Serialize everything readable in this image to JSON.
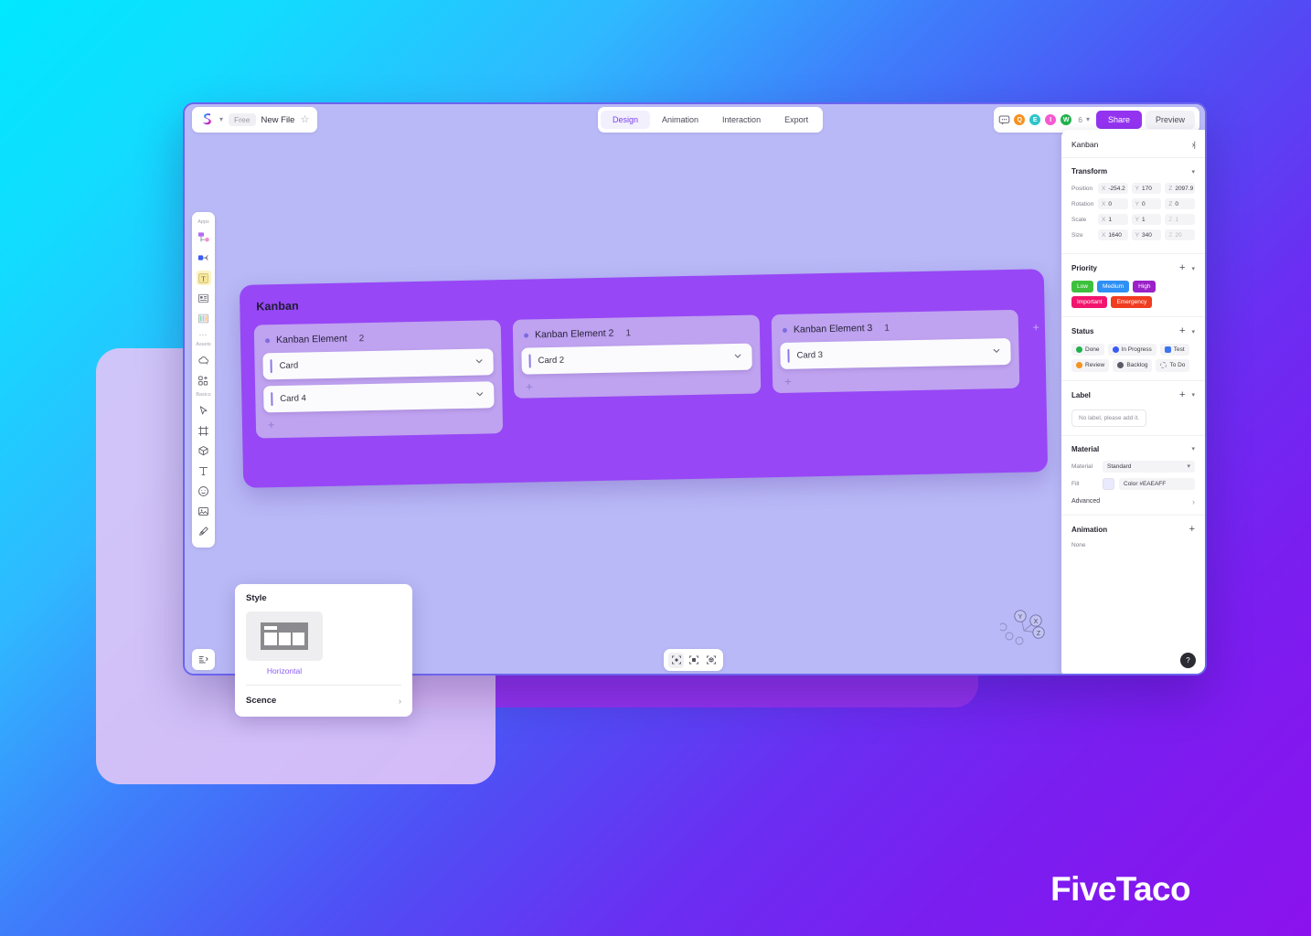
{
  "background": {
    "gradient_from": "#00e8ff",
    "gradient_to": "#8b12ee"
  },
  "brand": {
    "name": "FiveTaco"
  },
  "topbar": {
    "left": {
      "logo_icon": "app-logo-icon",
      "workspace_caret_icon": "chevron-down-icon",
      "plan_badge": "Free",
      "file_name": "New File",
      "favorite_icon": "star-icon"
    },
    "tabs": [
      {
        "label": "Design",
        "active": true
      },
      {
        "label": "Animation",
        "active": false
      },
      {
        "label": "Interaction",
        "active": false
      },
      {
        "label": "Export",
        "active": false
      }
    ],
    "right": {
      "comment_icon": "comment-icon",
      "avatars": [
        {
          "initial": "Q",
          "color": "#f5921e"
        },
        {
          "initial": "E",
          "color": "#2ec4c9"
        },
        {
          "initial": "I",
          "color": "#f45ad0"
        },
        {
          "initial": "W",
          "color": "#22b24c"
        }
      ],
      "avatar_count": "6",
      "avatar_caret_icon": "chevron-down-icon",
      "share_label": "Share",
      "preview_label": "Preview"
    }
  },
  "tool_rail": {
    "groups": [
      {
        "label": "Apps",
        "items": [
          {
            "icon": "flowchart-icon",
            "selected": false
          },
          {
            "icon": "mindmap-icon",
            "selected": false
          },
          {
            "icon": "sticky-note-icon",
            "selected": true
          },
          {
            "icon": "card-list-icon",
            "selected": false
          },
          {
            "icon": "kanban-icon",
            "selected": false
          },
          {
            "icon": "more-dots-icon",
            "selected": false
          }
        ]
      },
      {
        "label": "Assets",
        "items": [
          {
            "icon": "cloud-asset-icon",
            "selected": false
          },
          {
            "icon": "add-component-icon",
            "selected": false
          }
        ]
      },
      {
        "label": "Basics",
        "items": [
          {
            "icon": "cursor-icon",
            "selected": false
          },
          {
            "icon": "frame-icon",
            "selected": false
          },
          {
            "icon": "cube-icon",
            "selected": false
          },
          {
            "icon": "text-icon",
            "selected": false
          },
          {
            "icon": "emoji-icon",
            "selected": false
          },
          {
            "icon": "image-icon",
            "selected": false
          },
          {
            "icon": "pen-icon",
            "selected": false
          }
        ]
      }
    ],
    "panel_toggle_icon": "panel-toggle-icon"
  },
  "canvas": {
    "board": {
      "title": "Kanban",
      "add_column_icon": "add-column-icon",
      "columns": [
        {
          "name": "Kanban Element",
          "count": "2",
          "cards": [
            {
              "label": "Card"
            },
            {
              "label": "Card 4"
            }
          ],
          "add_card_icon": "add-card-icon"
        },
        {
          "name": "Kanban Element 2",
          "count": "1",
          "cards": [
            {
              "label": "Card 2"
            }
          ],
          "add_card_icon": "add-card-icon"
        },
        {
          "name": "Kanban Element 3",
          "count": "1",
          "cards": [
            {
              "label": "Card 3"
            }
          ],
          "add_card_icon": "add-card-icon"
        }
      ]
    },
    "gizmo": {
      "axes": [
        "Y",
        "X",
        "Z"
      ]
    },
    "bottom_tools": [
      {
        "icon": "fit-selection-icon",
        "active": true
      },
      {
        "icon": "fit-frame-icon",
        "active": false
      },
      {
        "icon": "zoom-to-fit-icon",
        "active": false
      }
    ]
  },
  "style_popup": {
    "title": "Style",
    "thumb_icon": "horizontal-layout-icon",
    "caption": "Horizontal",
    "scene_label": "Scence",
    "scene_chevron_icon": "chevron-right-icon"
  },
  "inspector": {
    "header": {
      "title": "Kanban",
      "collapse_icon": "collapse-panel-icon"
    },
    "transform": {
      "title": "Transform",
      "caret_icon": "chevron-down-icon",
      "rows": [
        {
          "label": "Position",
          "x": "-254.2",
          "y": "170",
          "z": "2097.9",
          "z_dim": false
        },
        {
          "label": "Rotation",
          "x": "0",
          "y": "0",
          "z": "0",
          "z_dim": false
        },
        {
          "label": "Scale",
          "x": "1",
          "y": "1",
          "z": "1",
          "z_dim": true
        },
        {
          "label": "Size",
          "x": "1640",
          "y": "340",
          "z": "20",
          "z_dim": true
        }
      ],
      "axis_labels": [
        "X",
        "Y",
        "Z"
      ]
    },
    "priority": {
      "title": "Priority",
      "add_icon": "plus-icon",
      "caret_icon": "chevron-down-icon",
      "chips": [
        {
          "label": "Low",
          "color": "#3ec03e"
        },
        {
          "label": "Medium",
          "color": "#2e90f5"
        },
        {
          "label": "High",
          "color": "#9b21c9"
        },
        {
          "label": "Important",
          "color": "#f2156d"
        },
        {
          "label": "Emergency",
          "color": "#f03c20"
        }
      ]
    },
    "status": {
      "title": "Status",
      "add_icon": "plus-icon",
      "caret_icon": "chevron-down-icon",
      "items": [
        {
          "label": "Done",
          "color": "#22b24c",
          "shape": "circle"
        },
        {
          "label": "In Progress",
          "color": "#3b5bf5",
          "shape": "circle"
        },
        {
          "label": "Test",
          "color": "#3d74f0",
          "shape": "square"
        },
        {
          "label": "Review",
          "color": "#f5921e",
          "shape": "circle"
        },
        {
          "label": "Backlog",
          "color": "#5a5a66",
          "shape": "circle"
        },
        {
          "label": "To Do",
          "color": "#9a9aa6",
          "shape": "ring"
        }
      ]
    },
    "label": {
      "title": "Label",
      "add_icon": "plus-icon",
      "caret_icon": "chevron-down-icon",
      "empty_text": "No label, please add it."
    },
    "material": {
      "title": "Material",
      "caret_icon": "chevron-down-icon",
      "material_label": "Material",
      "material_value": "Standard",
      "fill_label": "Fill",
      "fill_swatch": "#EAEAFF",
      "fill_value": "Color #EAEAFF",
      "advanced_label": "Advanced",
      "advanced_chevron_icon": "chevron-right-icon"
    },
    "animation": {
      "title": "Animation",
      "add_icon": "plus-icon",
      "value": "None"
    },
    "help_icon": "help-icon",
    "help_glyph": "?"
  }
}
